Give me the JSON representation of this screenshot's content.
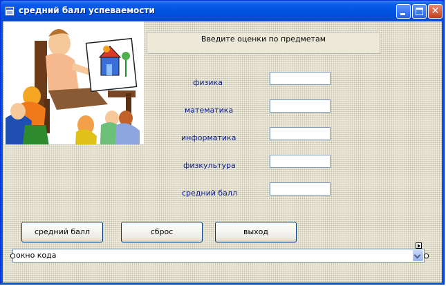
{
  "window": {
    "title": "средний балл успеваемости"
  },
  "prompt": {
    "text": "Введите оценки по предметам"
  },
  "subjects": [
    {
      "label": "физика",
      "value": ""
    },
    {
      "label": "математика",
      "value": ""
    },
    {
      "label": "информатика",
      "value": ""
    },
    {
      "label": "физкультура",
      "value": ""
    }
  ],
  "average": {
    "label": "средний балл",
    "value": ""
  },
  "buttons": {
    "average": "средний балл",
    "reset": "сброс",
    "exit": "выход"
  },
  "code_combo": {
    "value": "окно кода"
  },
  "colors": {
    "titlebar": "#0054e3",
    "label_text": "#0c1a8a",
    "client_bg": "#ece9d8"
  }
}
